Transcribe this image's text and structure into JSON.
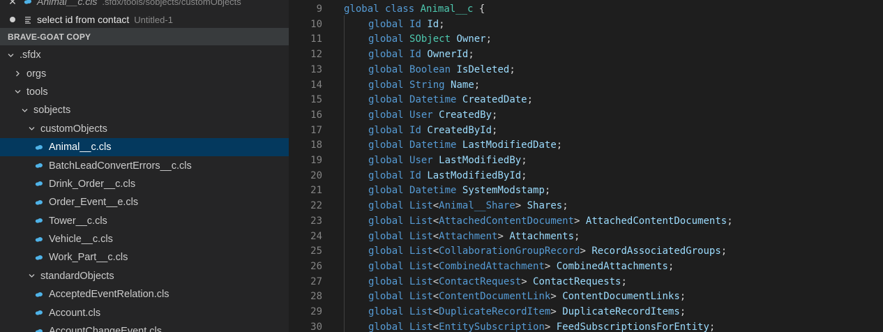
{
  "open_editors": [
    {
      "name": "Animal__c.cls",
      "description": ".sfdx/tools/sobjects/customObjects",
      "state": "close"
    },
    {
      "name": "select id from contact",
      "description": "Untitled-1",
      "state": "dirty"
    }
  ],
  "explorer": {
    "section_title": "BRAVE-GOAT COPY",
    "tree": [
      {
        "label": ".sfdx",
        "kind": "folder",
        "expanded": true,
        "depth": 0
      },
      {
        "label": "orgs",
        "kind": "folder",
        "expanded": false,
        "depth": 1
      },
      {
        "label": "tools",
        "kind": "folder",
        "expanded": true,
        "depth": 1
      },
      {
        "label": "sobjects",
        "kind": "folder",
        "expanded": true,
        "depth": 2
      },
      {
        "label": "customObjects",
        "kind": "folder",
        "expanded": true,
        "depth": 3
      },
      {
        "label": "Animal__c.cls",
        "kind": "file",
        "depth": 4,
        "selected": true
      },
      {
        "label": "BatchLeadConvertErrors__c.cls",
        "kind": "file",
        "depth": 4
      },
      {
        "label": "Drink_Order__c.cls",
        "kind": "file",
        "depth": 4
      },
      {
        "label": "Order_Event__e.cls",
        "kind": "file",
        "depth": 4
      },
      {
        "label": "Tower__c.cls",
        "kind": "file",
        "depth": 4
      },
      {
        "label": "Vehicle__c.cls",
        "kind": "file",
        "depth": 4
      },
      {
        "label": "Work_Part__c.cls",
        "kind": "file",
        "depth": 4
      },
      {
        "label": "standardObjects",
        "kind": "folder",
        "expanded": true,
        "depth": 3
      },
      {
        "label": "AcceptedEventRelation.cls",
        "kind": "file",
        "depth": 4
      },
      {
        "label": "Account.cls",
        "kind": "file",
        "depth": 4
      },
      {
        "label": "AccountChangeEvent.cls",
        "kind": "file",
        "depth": 4
      }
    ]
  },
  "editor": {
    "lines": [
      {
        "n": "9",
        "tokens": [
          [
            "kw",
            "global"
          ],
          [
            "pu",
            " "
          ],
          [
            "kw",
            "class"
          ],
          [
            "pu",
            " "
          ],
          [
            "ty",
            "Animal__c"
          ],
          [
            "pu",
            " {"
          ]
        ]
      },
      {
        "n": "10",
        "tokens": [
          [
            "kw",
            "global"
          ],
          [
            "pu",
            " "
          ],
          [
            "kw",
            "Id"
          ],
          [
            "pu",
            " "
          ],
          [
            "id",
            "Id"
          ],
          [
            "pu",
            ";"
          ]
        ]
      },
      {
        "n": "11",
        "tokens": [
          [
            "kw",
            "global"
          ],
          [
            "pu",
            " "
          ],
          [
            "ty",
            "SObject"
          ],
          [
            "pu",
            " "
          ],
          [
            "id",
            "Owner"
          ],
          [
            "pu",
            ";"
          ]
        ]
      },
      {
        "n": "12",
        "tokens": [
          [
            "kw",
            "global"
          ],
          [
            "pu",
            " "
          ],
          [
            "kw",
            "Id"
          ],
          [
            "pu",
            " "
          ],
          [
            "id",
            "OwnerId"
          ],
          [
            "pu",
            ";"
          ]
        ]
      },
      {
        "n": "13",
        "tokens": [
          [
            "kw",
            "global"
          ],
          [
            "pu",
            " "
          ],
          [
            "kw",
            "Boolean"
          ],
          [
            "pu",
            " "
          ],
          [
            "id",
            "IsDeleted"
          ],
          [
            "pu",
            ";"
          ]
        ]
      },
      {
        "n": "14",
        "tokens": [
          [
            "kw",
            "global"
          ],
          [
            "pu",
            " "
          ],
          [
            "kw",
            "String"
          ],
          [
            "pu",
            " "
          ],
          [
            "id",
            "Name"
          ],
          [
            "pu",
            ";"
          ]
        ]
      },
      {
        "n": "15",
        "tokens": [
          [
            "kw",
            "global"
          ],
          [
            "pu",
            " "
          ],
          [
            "kw",
            "Datetime"
          ],
          [
            "pu",
            " "
          ],
          [
            "id",
            "CreatedDate"
          ],
          [
            "pu",
            ";"
          ]
        ]
      },
      {
        "n": "16",
        "tokens": [
          [
            "kw",
            "global"
          ],
          [
            "pu",
            " "
          ],
          [
            "kw",
            "User"
          ],
          [
            "pu",
            " "
          ],
          [
            "id",
            "CreatedBy"
          ],
          [
            "pu",
            ";"
          ]
        ]
      },
      {
        "n": "17",
        "tokens": [
          [
            "kw",
            "global"
          ],
          [
            "pu",
            " "
          ],
          [
            "kw",
            "Id"
          ],
          [
            "pu",
            " "
          ],
          [
            "id",
            "CreatedById"
          ],
          [
            "pu",
            ";"
          ]
        ]
      },
      {
        "n": "18",
        "tokens": [
          [
            "kw",
            "global"
          ],
          [
            "pu",
            " "
          ],
          [
            "kw",
            "Datetime"
          ],
          [
            "pu",
            " "
          ],
          [
            "id",
            "LastModifiedDate"
          ],
          [
            "pu",
            ";"
          ]
        ]
      },
      {
        "n": "19",
        "tokens": [
          [
            "kw",
            "global"
          ],
          [
            "pu",
            " "
          ],
          [
            "kw",
            "User"
          ],
          [
            "pu",
            " "
          ],
          [
            "id",
            "LastModifiedBy"
          ],
          [
            "pu",
            ";"
          ]
        ]
      },
      {
        "n": "20",
        "tokens": [
          [
            "kw",
            "global"
          ],
          [
            "pu",
            " "
          ],
          [
            "kw",
            "Id"
          ],
          [
            "pu",
            " "
          ],
          [
            "id",
            "LastModifiedById"
          ],
          [
            "pu",
            ";"
          ]
        ]
      },
      {
        "n": "21",
        "tokens": [
          [
            "kw",
            "global"
          ],
          [
            "pu",
            " "
          ],
          [
            "kw",
            "Datetime"
          ],
          [
            "pu",
            " "
          ],
          [
            "id",
            "SystemModstamp"
          ],
          [
            "pu",
            ";"
          ]
        ]
      },
      {
        "n": "22",
        "tokens": [
          [
            "kw",
            "global"
          ],
          [
            "pu",
            " "
          ],
          [
            "kw",
            "List"
          ],
          [
            "pu",
            "<"
          ],
          [
            "kw",
            "Animal__Share"
          ],
          [
            "pu",
            "> "
          ],
          [
            "id",
            "Shares"
          ],
          [
            "pu",
            ";"
          ]
        ]
      },
      {
        "n": "23",
        "tokens": [
          [
            "kw",
            "global"
          ],
          [
            "pu",
            " "
          ],
          [
            "kw",
            "List"
          ],
          [
            "pu",
            "<"
          ],
          [
            "kw",
            "AttachedContentDocument"
          ],
          [
            "pu",
            "> "
          ],
          [
            "id",
            "AttachedContentDocuments"
          ],
          [
            "pu",
            ";"
          ]
        ]
      },
      {
        "n": "24",
        "tokens": [
          [
            "kw",
            "global"
          ],
          [
            "pu",
            " "
          ],
          [
            "kw",
            "List"
          ],
          [
            "pu",
            "<"
          ],
          [
            "kw",
            "Attachment"
          ],
          [
            "pu",
            "> "
          ],
          [
            "id",
            "Attachments"
          ],
          [
            "pu",
            ";"
          ]
        ]
      },
      {
        "n": "25",
        "tokens": [
          [
            "kw",
            "global"
          ],
          [
            "pu",
            " "
          ],
          [
            "kw",
            "List"
          ],
          [
            "pu",
            "<"
          ],
          [
            "kw",
            "CollaborationGroupRecord"
          ],
          [
            "pu",
            "> "
          ],
          [
            "id",
            "RecordAssociatedGroups"
          ],
          [
            "pu",
            ";"
          ]
        ]
      },
      {
        "n": "26",
        "tokens": [
          [
            "kw",
            "global"
          ],
          [
            "pu",
            " "
          ],
          [
            "kw",
            "List"
          ],
          [
            "pu",
            "<"
          ],
          [
            "kw",
            "CombinedAttachment"
          ],
          [
            "pu",
            "> "
          ],
          [
            "id",
            "CombinedAttachments"
          ],
          [
            "pu",
            ";"
          ]
        ]
      },
      {
        "n": "27",
        "tokens": [
          [
            "kw",
            "global"
          ],
          [
            "pu",
            " "
          ],
          [
            "kw",
            "List"
          ],
          [
            "pu",
            "<"
          ],
          [
            "kw",
            "ContactRequest"
          ],
          [
            "pu",
            "> "
          ],
          [
            "id",
            "ContactRequests"
          ],
          [
            "pu",
            ";"
          ]
        ]
      },
      {
        "n": "28",
        "tokens": [
          [
            "kw",
            "global"
          ],
          [
            "pu",
            " "
          ],
          [
            "kw",
            "List"
          ],
          [
            "pu",
            "<"
          ],
          [
            "kw",
            "ContentDocumentLink"
          ],
          [
            "pu",
            "> "
          ],
          [
            "id",
            "ContentDocumentLinks"
          ],
          [
            "pu",
            ";"
          ]
        ]
      },
      {
        "n": "29",
        "tokens": [
          [
            "kw",
            "global"
          ],
          [
            "pu",
            " "
          ],
          [
            "kw",
            "List"
          ],
          [
            "pu",
            "<"
          ],
          [
            "kw",
            "DuplicateRecordItem"
          ],
          [
            "pu",
            "> "
          ],
          [
            "id",
            "DuplicateRecordItems"
          ],
          [
            "pu",
            ";"
          ]
        ]
      },
      {
        "n": "30",
        "tokens": [
          [
            "kw",
            "global"
          ],
          [
            "pu",
            " "
          ],
          [
            "kw",
            "List"
          ],
          [
            "pu",
            "<"
          ],
          [
            "kw",
            "EntitySubscription"
          ],
          [
            "pu",
            "> "
          ],
          [
            "id",
            "FeedSubscriptionsForEntity"
          ],
          [
            "pu",
            ";"
          ]
        ]
      }
    ]
  },
  "colors": {
    "keyword": "#569cd6",
    "type": "#4ec9b0",
    "identifier": "#9cdcfe",
    "punctuation": "#d4d4d4",
    "salesforce_icon": "#4fb3e8",
    "selection": "#04395e"
  },
  "icons": {
    "close": "close-icon",
    "dirty": "dirty-dot-icon",
    "file_lines": "file-lines-icon",
    "chevron_down": "chevron-down-icon",
    "chevron_right": "chevron-right-icon",
    "salesforce_file": "salesforce-file-icon"
  }
}
